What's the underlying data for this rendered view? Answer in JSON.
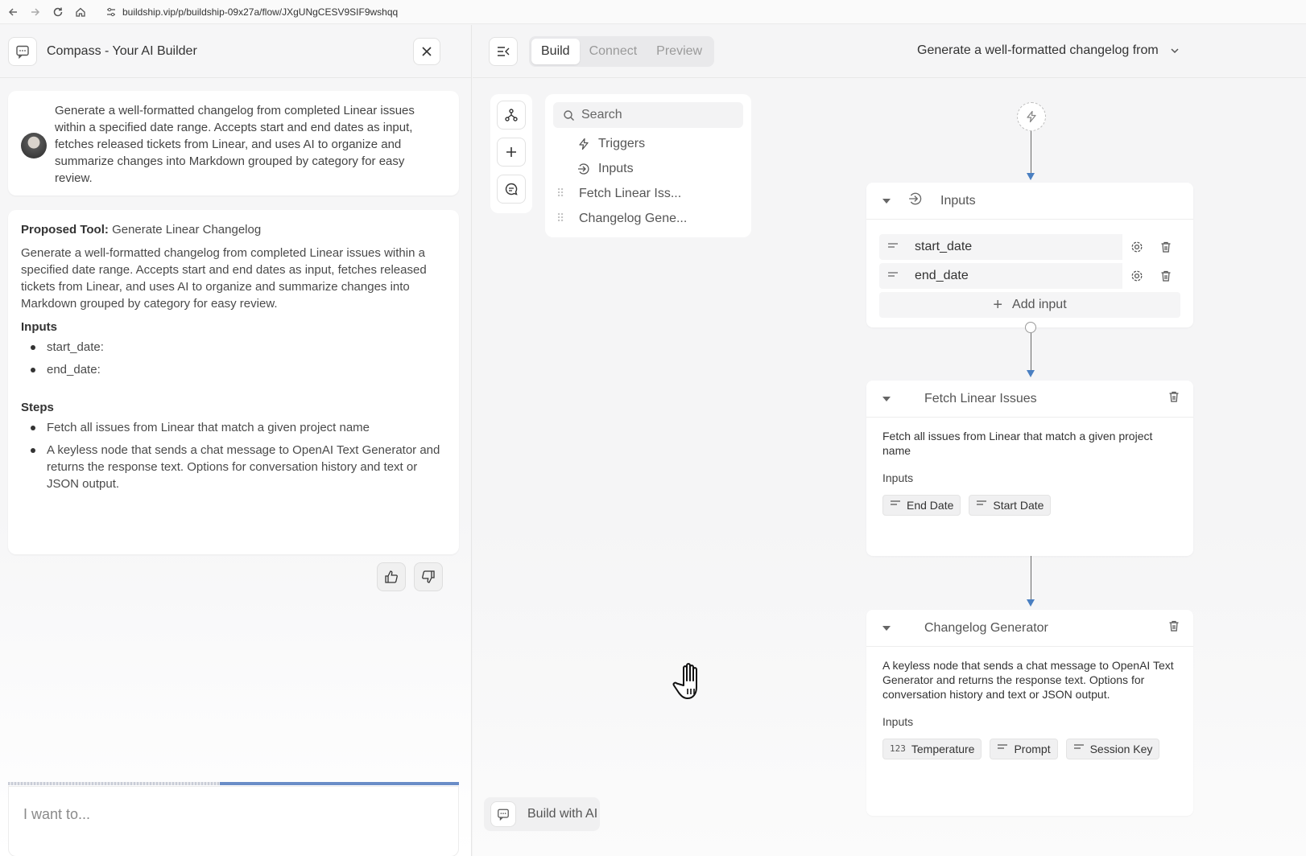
{
  "browser": {
    "url": "buildship.vip/p/buildship-09x27a/flow/JXgUNgCESV9SIF9wshqq",
    "icons": [
      "back-icon",
      "forward-icon",
      "reload-icon",
      "home-icon",
      "site-info-icon"
    ]
  },
  "compass": {
    "title": "Compass - Your AI Builder",
    "message": "Generate a well-formatted changelog from completed Linear issues within a specified date range. Accepts start and end dates as input, fetches released tickets from Linear, and uses AI to organize and summarize changes into Markdown grouped by category for easy review.",
    "proposal": {
      "label": "Proposed Tool:",
      "tool_name": "Generate Linear Changelog",
      "description": "Generate a well-formatted changelog from completed Linear issues within a specified date range. Accepts start and end dates as input, fetches released tickets from Linear, and uses AI to organize and summarize changes into Markdown grouped by category for easy review.",
      "inputs_heading": "Inputs",
      "inputs": [
        "start_date:",
        "end_date:"
      ],
      "steps_heading": "Steps",
      "steps": [
        "Fetch all issues from Linear that match a given project name",
        "A keyless node that sends a chat message to OpenAI Text Generator and returns the response text. Options for conversation history and text or JSON output."
      ]
    },
    "progress": 0.53,
    "chat_placeholder": "I want to..."
  },
  "builder": {
    "tabs": [
      {
        "label": "Build",
        "active": true
      },
      {
        "label": "Connect",
        "active": false
      },
      {
        "label": "Preview",
        "active": false
      }
    ],
    "flow_title": "Generate a well-formatted changelog from",
    "search_placeholder": "Search",
    "node_list": {
      "triggers": "Triggers",
      "inputs": "Inputs",
      "items": [
        "Fetch Linear Iss...",
        "Changelog Gene..."
      ]
    },
    "inputs_node": {
      "title": "Inputs",
      "rows": [
        "start_date",
        "end_date"
      ],
      "add_label": "Add input"
    },
    "fetch_node": {
      "title": "Fetch Linear Issues",
      "description": "Fetch all issues from Linear that match a given project name",
      "inputs_label": "Inputs",
      "chips": [
        "End Date",
        "Start Date"
      ]
    },
    "changelog_node": {
      "title": "Changelog Generator",
      "description": "A keyless node that sends a chat message to OpenAI Text Generator and returns the response text. Options for conversation history and text or JSON output.",
      "inputs_label": "Inputs",
      "chips": [
        {
          "label": "Temperature",
          "icon": "123"
        },
        {
          "label": "Prompt",
          "icon": "lines"
        },
        {
          "label": "Session Key",
          "icon": "lines"
        }
      ]
    },
    "build_ai_label": "Build with AI"
  },
  "colors": {
    "accent": "#4a7fc1",
    "progress": "#6a8dc7"
  }
}
